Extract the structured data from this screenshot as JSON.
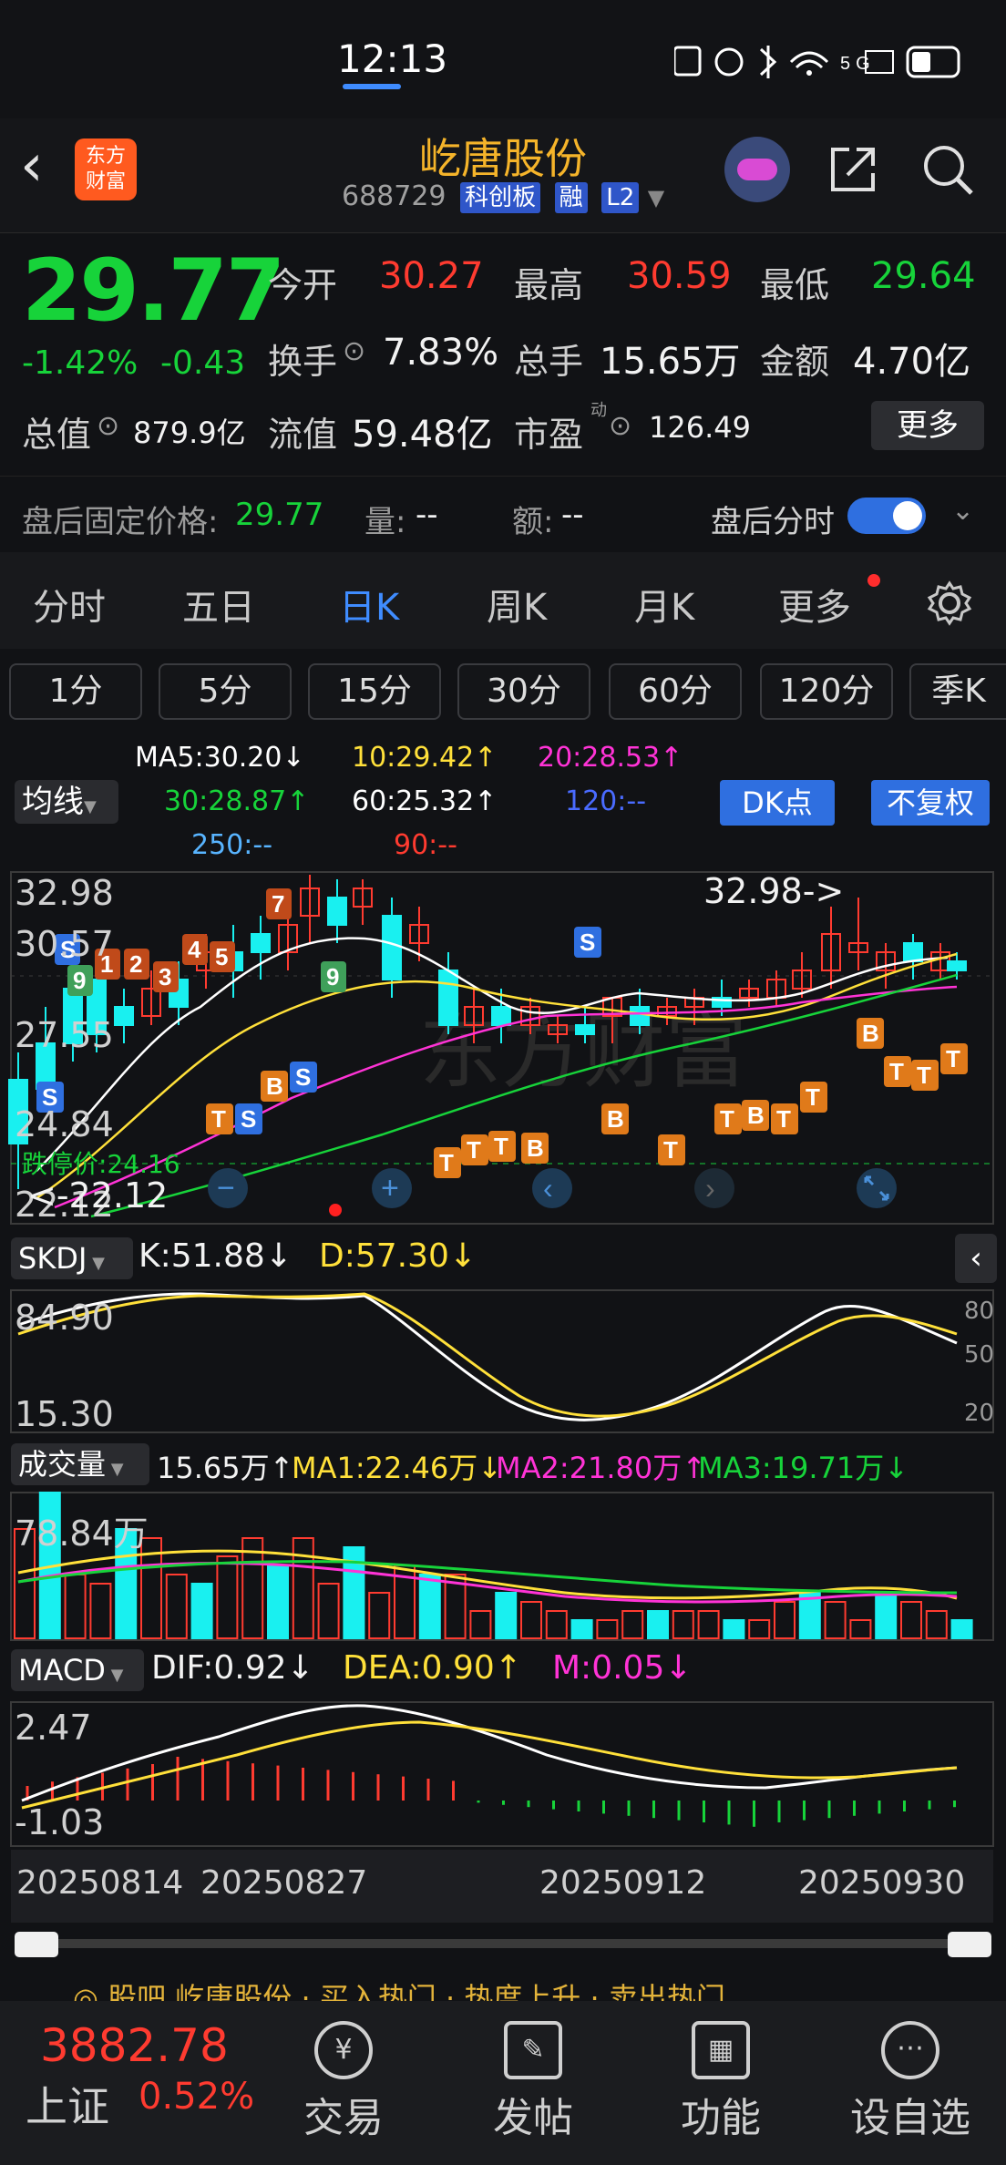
{
  "status": {
    "time": "12:13",
    "icons": "NFC alarm bluetooth wifi 5G battery"
  },
  "header": {
    "logo_line1": "东方",
    "logo_line2": "财富",
    "name": "屹唐股份",
    "code": "688729",
    "tag1": "科创板",
    "tag2": "融",
    "tag3": "L2"
  },
  "quote": {
    "price": "29.77",
    "pct": "-1.42%",
    "chg": "-0.43",
    "open_label": "今开",
    "open": "30.27",
    "high_label": "最高",
    "high": "30.59",
    "low_label": "最低",
    "low": "29.64",
    "turnover_label": "换手",
    "turnover": "7.83%",
    "volume_label": "总手",
    "volume": "15.65万",
    "amount_label": "金额",
    "amount": "4.70亿",
    "mcap_label": "总值",
    "mcap": "879.9亿",
    "float_label": "流值",
    "float": "59.48亿",
    "pe_label": "市盈",
    "pe_sup": "动",
    "pe": "126.49",
    "more": "更多"
  },
  "afterhours": {
    "label": "盘后固定价格:",
    "price": "29.77",
    "vol_label": "量:",
    "vol": "--",
    "amt_label": "额:",
    "amt": "--",
    "switch_label": "盘后分时"
  },
  "tabs": [
    "分时",
    "五日",
    "日K",
    "周K",
    "月K",
    "更多"
  ],
  "intervals": [
    "1分",
    "5分",
    "15分",
    "30分",
    "60分",
    "120分",
    "季K"
  ],
  "ma_legend": {
    "btn": "均线",
    "ma5": "MA5:30.20↓",
    "ma10": "10:29.42↑",
    "ma20": "20:28.53↑",
    "ma30": "30:28.87↑",
    "ma60": "60:25.32↑",
    "ma120": "120:--",
    "ma250": "250:--",
    "ma90": "90:--",
    "dk": "DK点",
    "fq": "不复权"
  },
  "kline": {
    "y_top": "32.98",
    "y_mid1": "30.57",
    "y_mid2": "27.55",
    "y_mid3": "24.84",
    "y_bot": "22.12",
    "max_label": "32.98->",
    "min_label": "<-22.12",
    "limit_down": "跌停价:24.16"
  },
  "skdj": {
    "btn": "SKDJ",
    "k": "K:51.88↓",
    "d": "D:57.30↓",
    "top": "84.90",
    "bot": "15.30",
    "r80": "80",
    "r50": "50",
    "r20": "20"
  },
  "volume": {
    "btn": "成交量",
    "v": "15.65万↑",
    "ma1": "MA1:22.46万↓",
    "ma2": "MA2:21.80万↑",
    "ma3": "MA3:19.71万↓",
    "top": "78.84万"
  },
  "macd": {
    "btn": "MACD",
    "dif": "DIF:0.92↓",
    "dea": "DEA:0.90↑",
    "m": "M:0.05↓",
    "top": "2.47",
    "bot": "-1.03"
  },
  "dates": [
    "20250814",
    "20250827",
    "20250912",
    "20250930"
  ],
  "bottom": {
    "index_value": "3882.78",
    "index_name": "上证",
    "index_pct": "0.52%",
    "trade": "交易",
    "post": "发帖",
    "func": "功能",
    "fav": "设自选",
    "ticker": "◎ 股吧  屹唐股份 · 买入热门 · 热度上升 · 卖出热门"
  },
  "colors": {
    "up": "#ff3b30",
    "down": "#17d33a",
    "accent": "#3f8cff",
    "candle_down_fill": "#19f0f0"
  }
}
